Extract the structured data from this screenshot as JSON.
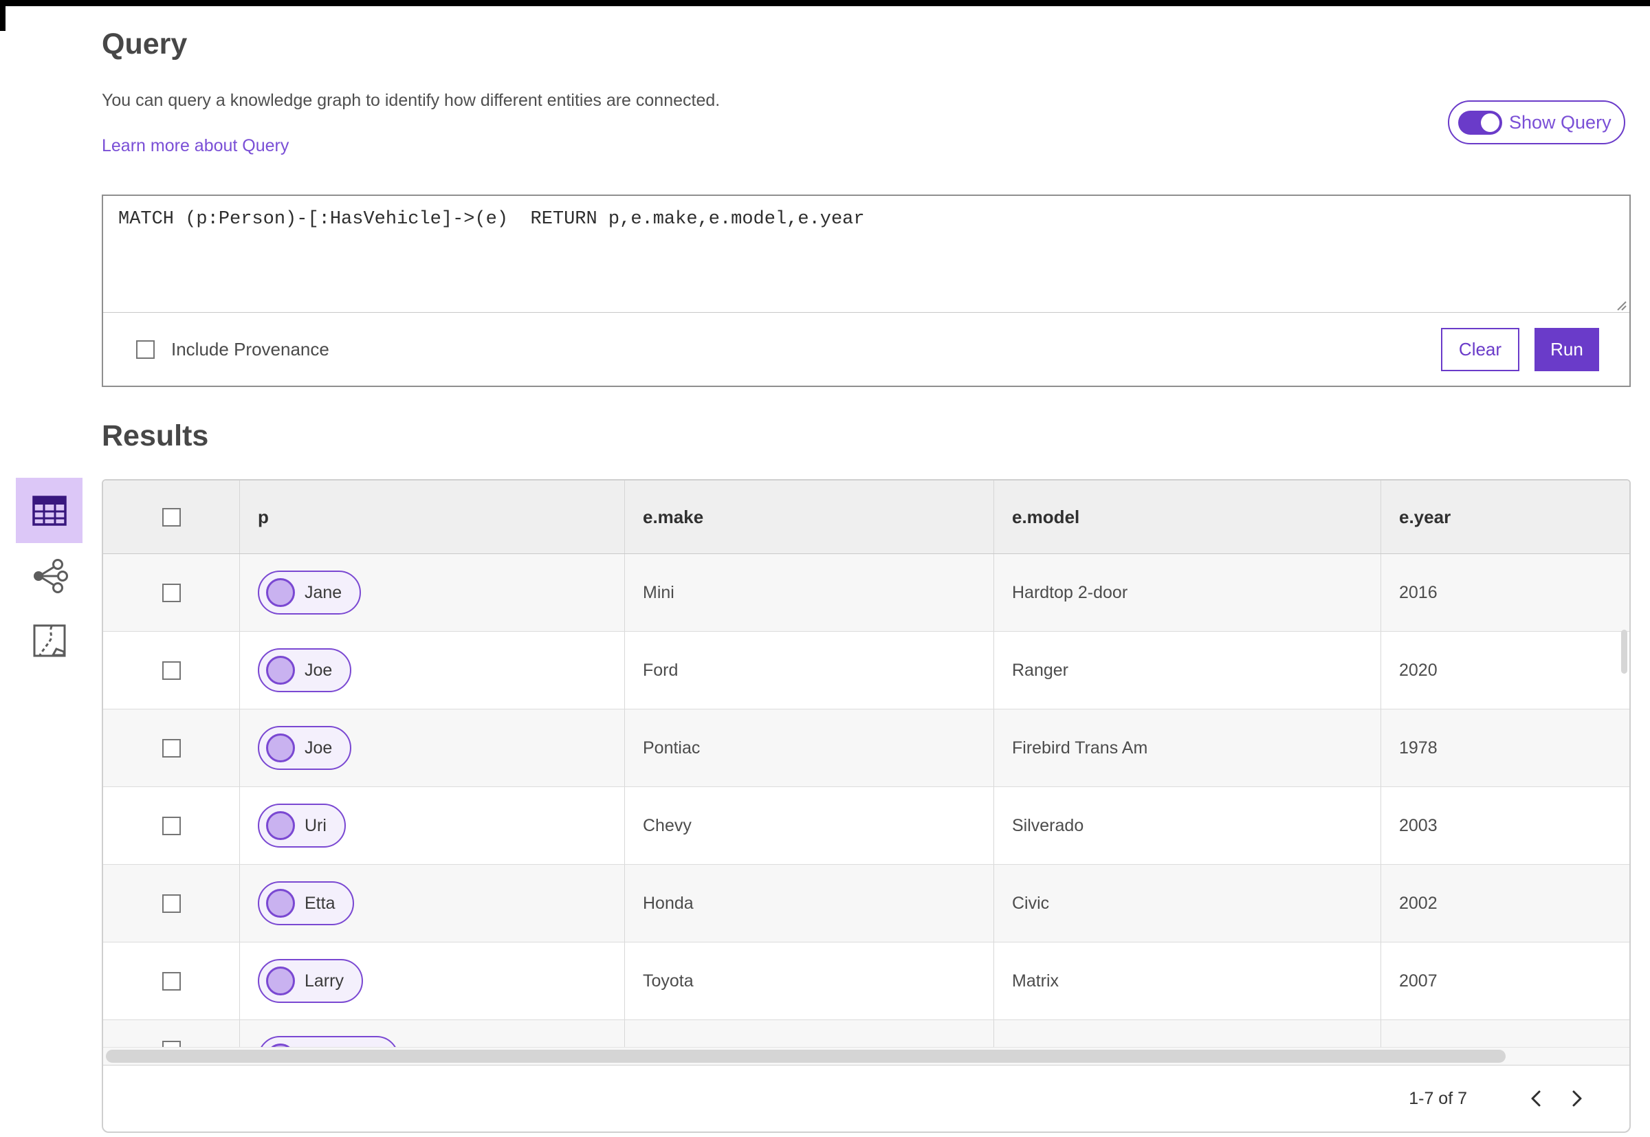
{
  "colors": {
    "accent": "#6a3bc9",
    "link_purple": "#7a4fd6",
    "chip_border": "#7a48d2",
    "chip_fill": "#f4f0fc",
    "chip_circle": "#c9b2f0",
    "selected_view_bg": "#dcc7f7",
    "table_header_bg": "#efefef",
    "alt_row_bg": "#f7f7f7"
  },
  "query_section": {
    "title": "Query",
    "description": "You can query a knowledge graph to identify how different entities are connected.",
    "learn_more": "Learn more about Query",
    "show_query_label": "Show Query",
    "show_query_state": "on",
    "query_text": "MATCH (p:Person)-[:HasVehicle]->(e)  RETURN p,e.make,e.model,e.year",
    "include_provenance_label": "Include Provenance",
    "include_provenance_checked": false,
    "clear_label": "Clear",
    "run_label": "Run"
  },
  "results_section": {
    "title": "Results",
    "view_icons": [
      {
        "name": "table-view-icon",
        "selected": true
      },
      {
        "name": "link-chart-view-icon",
        "selected": false
      },
      {
        "name": "map-view-icon",
        "selected": false
      }
    ],
    "table": {
      "columns": [
        "p",
        "e.make",
        "e.model",
        "e.year"
      ],
      "rows": [
        {
          "p": "Jane",
          "e_make": "Mini",
          "e_model": "Hardtop 2-door",
          "e_year": "2016"
        },
        {
          "p": "Joe",
          "e_make": "Ford",
          "e_model": "Ranger",
          "e_year": "2020"
        },
        {
          "p": "Joe",
          "e_make": "Pontiac",
          "e_model": "Firebird Trans Am",
          "e_year": "1978"
        },
        {
          "p": "Uri",
          "e_make": "Chevy",
          "e_model": "Silverado",
          "e_year": "2003"
        },
        {
          "p": "Etta",
          "e_make": "Honda",
          "e_model": "Civic",
          "e_year": "2002"
        },
        {
          "p": "Larry",
          "e_make": "Toyota",
          "e_model": "Matrix",
          "e_year": "2007"
        },
        {
          "p": "",
          "e_make": "",
          "e_model": "",
          "e_year": "",
          "partial": true
        }
      ]
    },
    "pagination": {
      "range_label": "1-7 of 7"
    }
  }
}
